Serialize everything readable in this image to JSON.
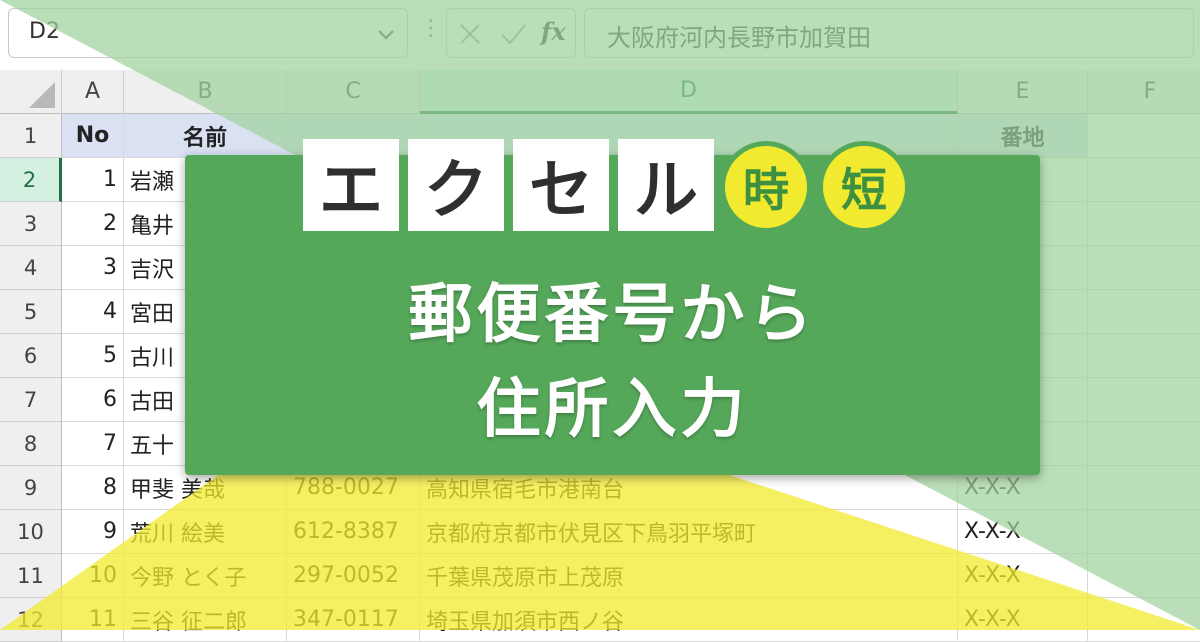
{
  "formula_bar": {
    "name_box": "D2",
    "formula": "大阪府河内長野市加賀田",
    "fx_label": "fx"
  },
  "columns": [
    "A",
    "B",
    "C",
    "D",
    "E",
    "F"
  ],
  "rows": [
    "1",
    "2",
    "3",
    "4",
    "5",
    "6",
    "7",
    "8",
    "9",
    "10",
    "11",
    "12"
  ],
  "table": {
    "headers": {
      "no": "No",
      "name": "名前",
      "address_num": "番地"
    },
    "records": [
      {
        "no": "1",
        "name": "岩瀬",
        "zip": "",
        "address": "",
        "num": ""
      },
      {
        "no": "2",
        "name": "亀井",
        "zip": "",
        "address": "",
        "num": ""
      },
      {
        "no": "3",
        "name": "吉沢",
        "zip": "",
        "address": "",
        "num": ""
      },
      {
        "no": "4",
        "name": "宮田",
        "zip": "",
        "address": "",
        "num": ""
      },
      {
        "no": "5",
        "name": "古川",
        "zip": "",
        "address": "",
        "num": ""
      },
      {
        "no": "6",
        "name": "古田",
        "zip": "",
        "address": "",
        "num": ""
      },
      {
        "no": "7",
        "name": "五十",
        "zip": "",
        "address": "",
        "num": ""
      },
      {
        "no": "8",
        "name": "甲斐 美哉",
        "zip": "788-0027",
        "address": "高知県宿毛市港南台",
        "num": "X-X-X"
      },
      {
        "no": "9",
        "name": "荒川 絵美",
        "zip": "612-8387",
        "address": "京都府京都市伏見区下鳥羽平塚町",
        "num": "X-X-X"
      },
      {
        "no": "10",
        "name": "今野 とく子",
        "zip": "297-0052",
        "address": "千葉県茂原市上茂原",
        "num": "X-X-X"
      },
      {
        "no": "11",
        "name": "三谷 征二郎",
        "zip": "347-0117",
        "address": "埼玉県加須市西ノ谷",
        "num": "X-X-X"
      }
    ]
  },
  "banner": {
    "logo_kana": [
      "エ",
      "ク",
      "セ",
      "ル"
    ],
    "logo_kanji": [
      "時",
      "短"
    ],
    "line1": "郵便番号から",
    "line2": "住所入力"
  },
  "colors": {
    "banner_green": "#55a85a",
    "overlay_green": "#9fd29c",
    "overlay_yellow": "#f2ea2e",
    "excel_green": "#1e7145"
  }
}
